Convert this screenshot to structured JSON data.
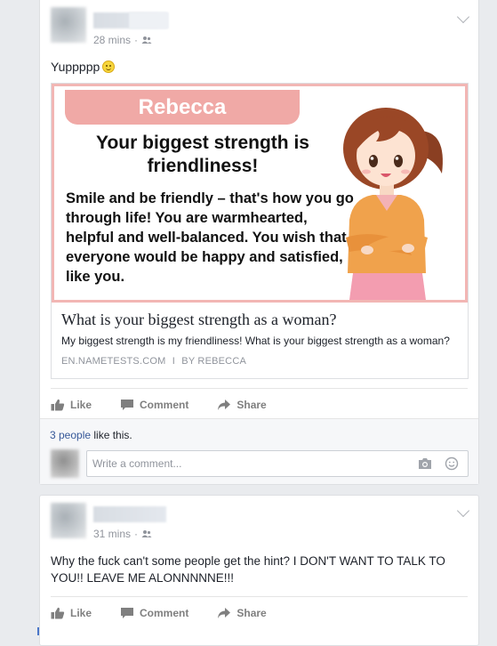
{
  "posts": [
    {
      "timestamp": "28 mins",
      "text": "Yuppppp",
      "link": {
        "image": {
          "name": "Rebecca",
          "headline": "Your biggest strength is friendliness!",
          "body": "Smile and be friendly – that's how you go through life! You are warmhearted, helpful and well-balanced. You wish that everyone would be happy and satisfied, like you."
        },
        "title": "What is your biggest strength as a woman?",
        "description": "My biggest strength is my friendliness! What is your biggest strength as a woman?",
        "domain": "EN.NAMETESTS.COM",
        "separator": "I",
        "byline": "BY REBECCA"
      },
      "actions": {
        "like": "Like",
        "comment": "Comment",
        "share": "Share"
      },
      "likes": {
        "link_text": "3 people",
        "rest": " like this."
      },
      "comment_placeholder": "Write a comment..."
    },
    {
      "timestamp": "31 mins",
      "text": "Why the fuck can't some people get the hint? I DON'T WANT TO TALK TO YOU!! LEAVE ME ALONNNNNE!!!",
      "actions": {
        "like": "Like",
        "comment": "Comment",
        "share": "Share"
      }
    }
  ],
  "colors": {
    "page_bg": "#e9ebee",
    "link_blue": "#365899",
    "banner_pink": "#f0a9a6",
    "action_gray": "#7f7f7f"
  },
  "icons": [
    "chevron-down-icon",
    "friends-audience-icon",
    "smiley-emoji",
    "like-icon",
    "comment-icon",
    "share-icon",
    "camera-icon",
    "emoji-icon"
  ]
}
